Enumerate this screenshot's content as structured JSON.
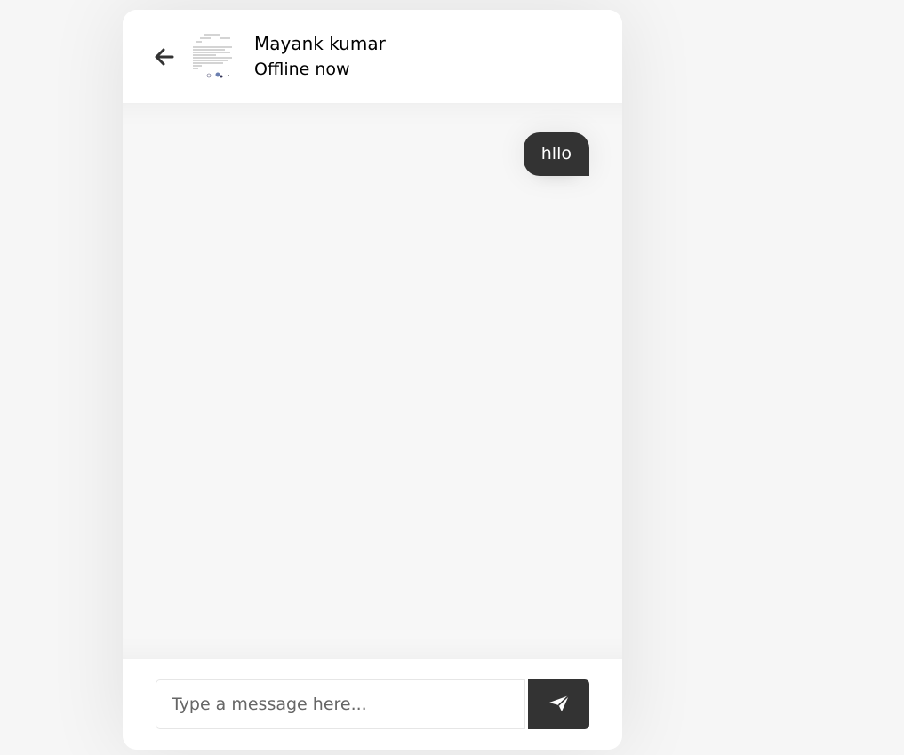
{
  "header": {
    "back_icon": "arrow-left-icon",
    "name": "Mayank kumar",
    "status": "Offline now"
  },
  "messages": [
    {
      "direction": "outgoing",
      "text": "hllo"
    }
  ],
  "typing": {
    "placeholder": "Type a message here...",
    "value": "",
    "send_icon": "paper-plane-icon"
  },
  "colors": {
    "accent": "#333333",
    "page_bg": "#f6f6f6",
    "chat_bg": "#f7f7f7"
  }
}
